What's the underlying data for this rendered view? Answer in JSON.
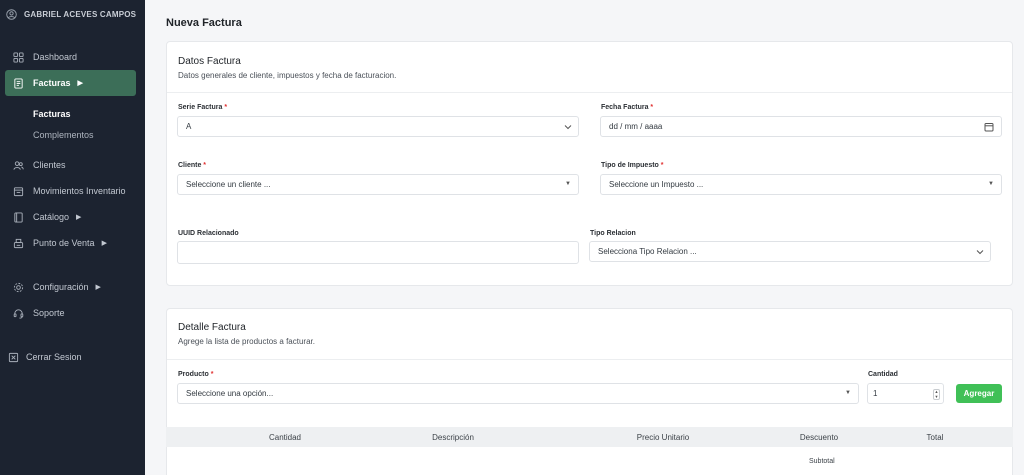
{
  "user": {
    "name": "GABRIEL ACEVES CAMPOS"
  },
  "sidebar": {
    "items": [
      {
        "label": "Dashboard"
      },
      {
        "label": "Facturas"
      },
      {
        "label": "Clientes"
      },
      {
        "label": "Movimientos Inventario"
      },
      {
        "label": "Catálogo"
      },
      {
        "label": "Punto de Venta"
      },
      {
        "label": "Configuración"
      },
      {
        "label": "Soporte"
      },
      {
        "label": "Cerrar Sesion"
      }
    ],
    "submenu": [
      {
        "label": "Facturas"
      },
      {
        "label": "Complementos"
      }
    ]
  },
  "page": {
    "title": "Nueva Factura"
  },
  "datos": {
    "title": "Datos Factura",
    "subtitle": "Datos generales de cliente, impuestos y fecha de facturacion.",
    "serie": {
      "label": "Serie Factura",
      "value": "A"
    },
    "fecha": {
      "label": "Fecha Factura",
      "placeholder": "dd / mm / aaaa"
    },
    "cliente": {
      "label": "Cliente",
      "placeholder": "Seleccione un cliente ..."
    },
    "impuesto": {
      "label": "Tipo de Impuesto",
      "placeholder": "Seleccione un Impuesto ..."
    },
    "uuid": {
      "label": "UUID Relacionado",
      "value": ""
    },
    "relacion": {
      "label": "Tipo Relacion",
      "placeholder": "Selecciona Tipo Relacion ..."
    }
  },
  "detalle": {
    "title": "Detalle Factura",
    "subtitle": "Agrege la lista de productos a facturar.",
    "producto": {
      "label": "Producto",
      "placeholder": "Seleccione una opción..."
    },
    "cantidad": {
      "label": "Cantidad",
      "value": "1"
    },
    "add_button": "Agregar",
    "columns": [
      "Cantidad",
      "Descripción",
      "Precio Unitario",
      "Descuento",
      "Total"
    ],
    "subtotal_label": "Subtotal"
  },
  "colors": {
    "sidebar_bg": "#1c2330",
    "active_nav": "#3c6e58",
    "add_button": "#40c057",
    "required": "#e03131"
  }
}
